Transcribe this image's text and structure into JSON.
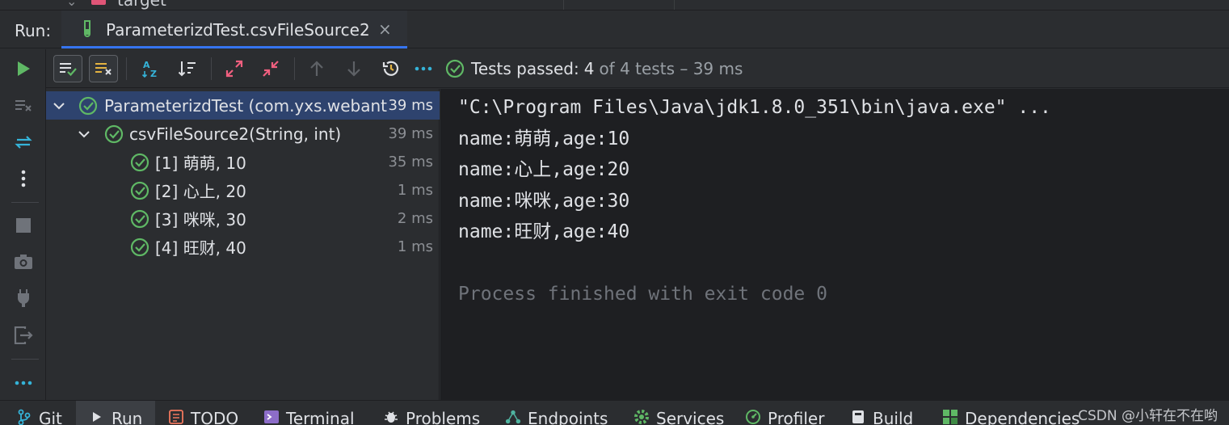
{
  "project_tree": {
    "folder_label": "target"
  },
  "run_panel": {
    "label": "Run:",
    "tab_title": "ParameterizdTest.csvFileSource2"
  },
  "toolbar": {
    "status": {
      "passed_label": "Tests passed:",
      "passed_count": "4",
      "of_total": "of 4 tests – 39 ms"
    }
  },
  "test_tree": {
    "rows": [
      {
        "name": "ParameterizdTest (com.yxs.webant",
        "time": "39 ms"
      },
      {
        "name": "csvFileSource2(String, int)",
        "time": "39 ms"
      },
      {
        "name": "[1] 萌萌, 10",
        "time": "35 ms"
      },
      {
        "name": "[2] 心上, 20",
        "time": "1 ms"
      },
      {
        "name": "[3] 咪咪, 30",
        "time": "2 ms"
      },
      {
        "name": "[4] 旺财, 40",
        "time": "1 ms"
      }
    ]
  },
  "console": {
    "lines": [
      "\"C:\\Program Files\\Java\\jdk1.8.0_351\\bin\\java.exe\" ...",
      "name:萌萌,age:10",
      "name:心上,age:20",
      "name:咪咪,age:30",
      "name:旺财,age:40",
      "",
      "Process finished with exit code 0"
    ]
  },
  "bottom_bar": {
    "items": [
      "Git",
      "Run",
      "TODO",
      "Terminal",
      "Problems",
      "Endpoints",
      "Services",
      "Profiler",
      "Build",
      "Dependencies"
    ]
  },
  "watermark": "CSDN @小轩在不在哟",
  "colors": {
    "accent": "#3574f0",
    "pass_green": "#5fb865",
    "rerun_green": "#5fb865",
    "console_bg": "#1e1f22",
    "panel_bg": "#2b2d30",
    "selection": "#2e436e"
  }
}
